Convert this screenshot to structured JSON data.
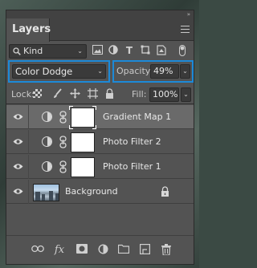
{
  "panel": {
    "title": "Layers"
  },
  "filter": {
    "kind_label": "Kind"
  },
  "blend": {
    "mode": "Color Dodge",
    "opacity_label": "Opacity:",
    "opacity_value": "49%"
  },
  "lock": {
    "label": "Lock:",
    "fill_label": "Fill:",
    "fill_value": "100%"
  },
  "layers": [
    {
      "name": "Gradient Map 1",
      "selected": true
    },
    {
      "name": "Photo Filter 2",
      "selected": false
    },
    {
      "name": "Photo Filter 1",
      "selected": false
    },
    {
      "name": "Background",
      "selected": false
    }
  ],
  "bottom_toolbar": {
    "fx_label": "fx"
  },
  "colors": {
    "highlight_border": "#1c8ad8",
    "panel_bg": "#535353",
    "selected_row": "#6a6a6a"
  }
}
